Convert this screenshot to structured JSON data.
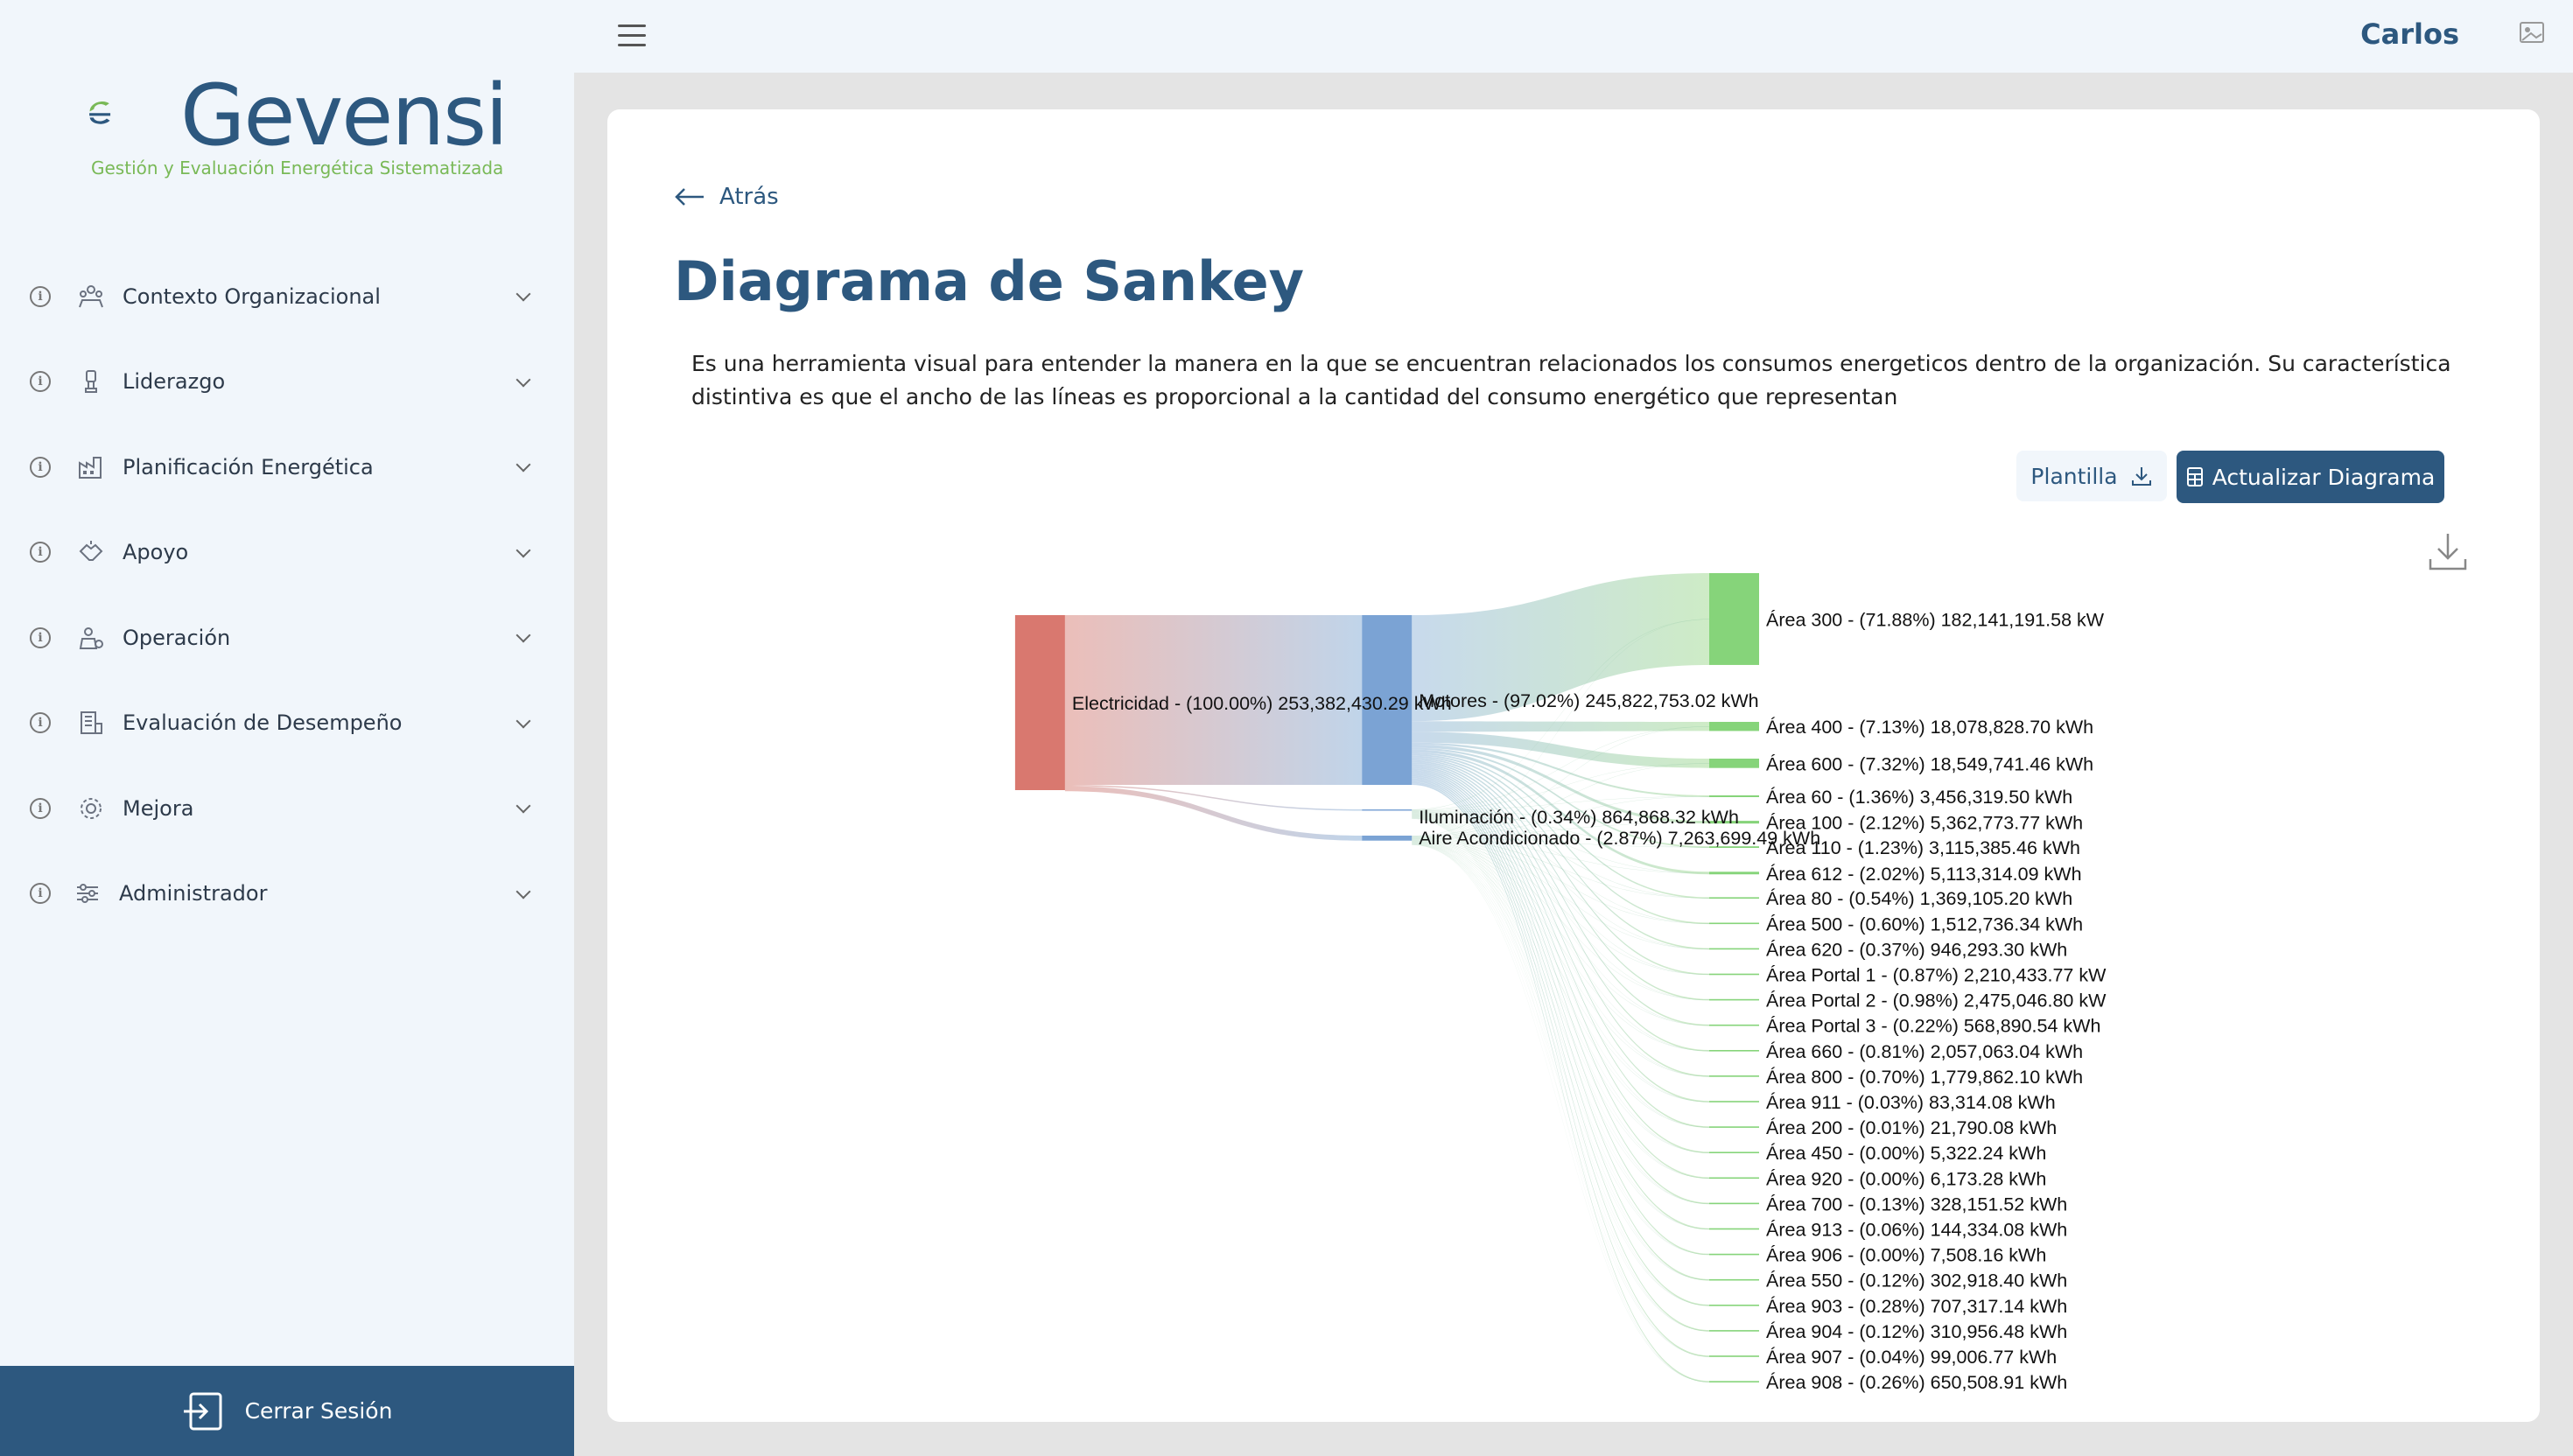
{
  "brand": {
    "name": "Gevensi",
    "tagline": "Gestión y Evaluación Energética Sistematizada",
    "primary_color": "#2d587f",
    "accent_color": "#79b957"
  },
  "header": {
    "user": "Carlos",
    "menu_icon": "hamburger-icon"
  },
  "sidebar": {
    "items": [
      {
        "label": "Contexto Organizacional",
        "icon": "people-icon"
      },
      {
        "label": "Liderazgo",
        "icon": "trophy-icon"
      },
      {
        "label": "Planificación Energética",
        "icon": "factory-icon"
      },
      {
        "label": "Apoyo",
        "icon": "handshake-icon"
      },
      {
        "label": "Operación",
        "icon": "operation-icon"
      },
      {
        "label": "Evaluación de Desempeño",
        "icon": "building-icon"
      },
      {
        "label": "Mejora",
        "icon": "gear-icon"
      },
      {
        "label": "Administrador",
        "icon": "sliders-icon"
      }
    ],
    "logout_label": "Cerrar Sesión"
  },
  "page": {
    "back_label": "Atrás",
    "title": "Diagrama de Sankey",
    "description": "Es una herramienta visual para entender la manera en la que se encuentran relacionados los consumos energeticos dentro de la organización. Su característica distintiva es que el ancho de las líneas es proporcional a la cantidad del consumo energético que representan",
    "template_button": "Plantilla",
    "update_button": "Actualizar Diagrama"
  },
  "chart_data": {
    "type": "sankey",
    "colors": {
      "source": "#d9786f",
      "mid": "#7ba3d4",
      "target": "#86d47a"
    },
    "nodes": [
      {
        "id": "electricidad",
        "label": "Electricidad - (100.00%) 253,382,430.29 kWh",
        "value": 253382430.29,
        "column": 0
      },
      {
        "id": "motores",
        "label": "Motores - (97.02%) 245,822,753.02 kWh",
        "value": 245822753.02,
        "column": 1
      },
      {
        "id": "iluminacion",
        "label": "Iluminación - (0.34%) 864,868.32 kWh",
        "value": 864868.32,
        "column": 1
      },
      {
        "id": "aire",
        "label": "Aire Acondicionado - (2.87%) 7,263,699.49 kWh",
        "value": 7263699.49,
        "column": 1
      }
    ],
    "targets": [
      {
        "label": "Área 300 - (71.88%) 182,141,191.58 kW",
        "value": 182141191.58
      },
      {
        "label": "Área 400 - (7.13%) 18,078,828.70 kWh",
        "value": 18078828.7
      },
      {
        "label": "Área 600 - (7.32%) 18,549,741.46 kWh",
        "value": 18549741.46
      },
      {
        "label": "Área 60 - (1.36%) 3,456,319.50 kWh",
        "value": 3456319.5
      },
      {
        "label": "Área 100 - (2.12%) 5,362,773.77 kWh",
        "value": 5362773.77
      },
      {
        "label": "Área 110 - (1.23%) 3,115,385.46 kWh",
        "value": 3115385.46
      },
      {
        "label": "Área 612 - (2.02%) 5,113,314.09 kWh",
        "value": 5113314.09
      },
      {
        "label": "Área 80 - (0.54%) 1,369,105.20 kWh",
        "value": 1369105.2
      },
      {
        "label": "Área 500 - (0.60%) 1,512,736.34 kWh",
        "value": 1512736.34
      },
      {
        "label": "Área 620 - (0.37%) 946,293.30 kWh",
        "value": 946293.3
      },
      {
        "label": "Área Portal 1 - (0.87%) 2,210,433.77 kW",
        "value": 2210433.77
      },
      {
        "label": "Área Portal 2 - (0.98%) 2,475,046.80 kW",
        "value": 2475046.8
      },
      {
        "label": "Área Portal 3 - (0.22%) 568,890.54 kWh",
        "value": 568890.54
      },
      {
        "label": "Área 660 - (0.81%) 2,057,063.04 kWh",
        "value": 2057063.04
      },
      {
        "label": "Área 800 - (0.70%) 1,779,862.10 kWh",
        "value": 1779862.1
      },
      {
        "label": "Área 911 - (0.03%) 83,314.08 kWh",
        "value": 83314.08
      },
      {
        "label": "Área 200 - (0.01%) 21,790.08 kWh",
        "value": 21790.08
      },
      {
        "label": "Área 450 - (0.00%) 5,322.24 kWh",
        "value": 5322.24
      },
      {
        "label": "Área 920 - (0.00%) 6,173.28 kWh",
        "value": 6173.28
      },
      {
        "label": "Área 700 - (0.13%) 328,151.52 kWh",
        "value": 328151.52
      },
      {
        "label": "Área 913 - (0.06%) 144,334.08 kWh",
        "value": 144334.08
      },
      {
        "label": "Área 906 - (0.00%) 7,508.16 kWh",
        "value": 7508.16
      },
      {
        "label": "Área 550 - (0.12%) 302,918.40 kWh",
        "value": 302918.4
      },
      {
        "label": "Área 903 - (0.28%) 707,317.14 kWh",
        "value": 707317.14
      },
      {
        "label": "Área 904 - (0.12%) 310,956.48 kWh",
        "value": 310956.48
      },
      {
        "label": "Área 907 - (0.04%) 99,006.77 kWh",
        "value": 99006.77
      },
      {
        "label": "Área 908 - (0.26%) 650,508.91 kWh",
        "value": 650508.91
      }
    ]
  }
}
